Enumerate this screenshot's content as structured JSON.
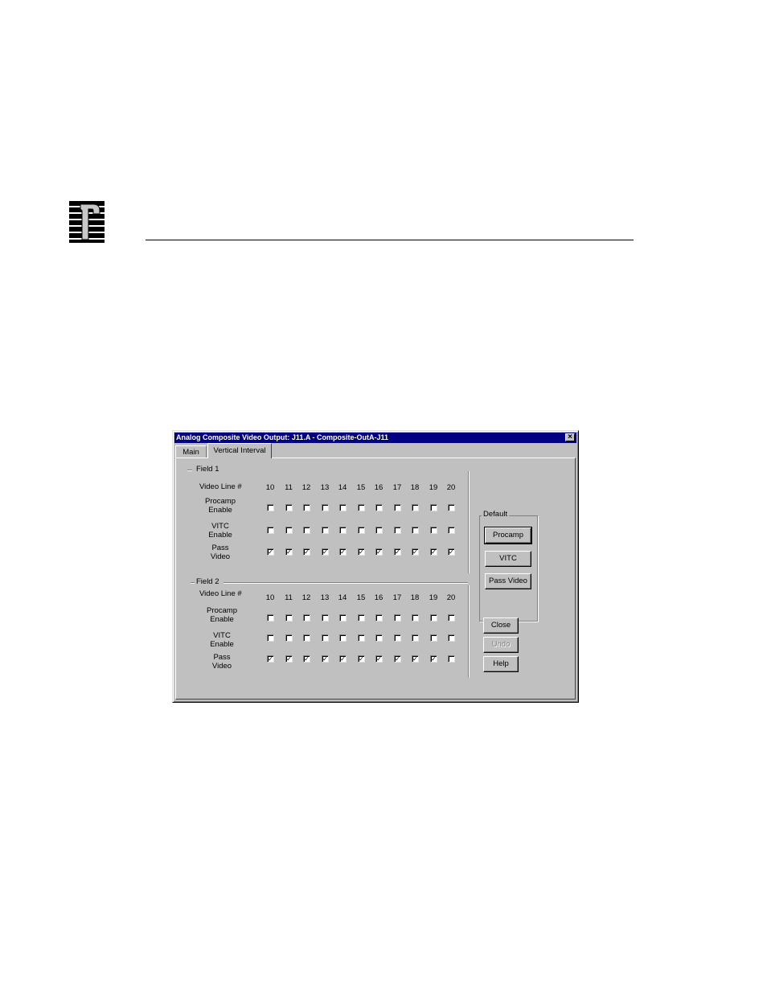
{
  "dialog": {
    "title": "Analog Composite Video Output: J11.A - Composite-OutA-J11",
    "close_glyph": "×"
  },
  "tabs": [
    {
      "label": "Main",
      "active": false
    },
    {
      "label": "Vertical Interval",
      "active": true
    }
  ],
  "line_numbers": [
    "10",
    "11",
    "12",
    "13",
    "14",
    "15",
    "16",
    "17",
    "18",
    "19",
    "20"
  ],
  "field1": {
    "label": "Field 1",
    "video_line_label": "Video Line #",
    "procamp_label": [
      "Procamp",
      "Enable"
    ],
    "vitc_label": [
      "VITC",
      "Enable"
    ],
    "pass_label": [
      "Pass",
      "Video"
    ],
    "procamp": [
      false,
      false,
      false,
      false,
      false,
      false,
      false,
      false,
      false,
      false,
      false
    ],
    "vitc": [
      false,
      false,
      false,
      false,
      false,
      false,
      false,
      false,
      false,
      false,
      false
    ],
    "pass_video": [
      true,
      true,
      true,
      true,
      true,
      true,
      true,
      true,
      true,
      true,
      true
    ]
  },
  "field2": {
    "label": "Field 2",
    "video_line_label": "Video Line #",
    "procamp_label": [
      "Procamp",
      "Enable"
    ],
    "vitc_label": [
      "VITC",
      "Enable"
    ],
    "pass_label": [
      "Pass",
      "Video"
    ],
    "procamp": [
      false,
      false,
      false,
      false,
      false,
      false,
      false,
      false,
      false,
      false,
      false
    ],
    "vitc": [
      false,
      false,
      false,
      false,
      false,
      false,
      false,
      false,
      false,
      false,
      false
    ],
    "pass_video": [
      true,
      true,
      true,
      true,
      true,
      true,
      true,
      true,
      true,
      true,
      false
    ]
  },
  "default_group": {
    "label": "Default",
    "procamp_button": "Procamp",
    "vitc_button": "VITC",
    "pass_video_button": "Pass Video"
  },
  "actions": {
    "close": "Close",
    "undo": "Undo",
    "help": "Help"
  },
  "colors": {
    "titlebar": "#000080",
    "face": "#c0c0c0"
  }
}
